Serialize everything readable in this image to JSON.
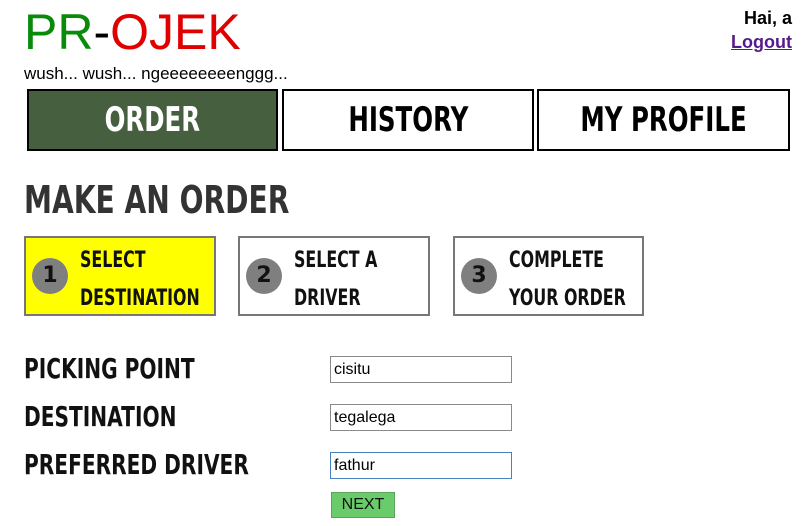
{
  "brand": {
    "part1": "PR",
    "separator": "-",
    "part2": "OJEK",
    "tagline": "wush... wush... ngeeeeeeeenggg..."
  },
  "user": {
    "greeting": "Hai, a",
    "logout_label": "Logout"
  },
  "nav": {
    "tabs": [
      {
        "label": "ORDER"
      },
      {
        "label": "HISTORY"
      },
      {
        "label": "MY PROFILE"
      }
    ]
  },
  "page": {
    "title": "MAKE AN ORDER"
  },
  "steps": [
    {
      "number": "1",
      "line1": "SELECT",
      "line2": "DESTINATION"
    },
    {
      "number": "2",
      "line1": "SELECT A",
      "line2": "DRIVER"
    },
    {
      "number": "3",
      "line1": "COMPLETE",
      "line2": "YOUR ORDER"
    }
  ],
  "form": {
    "picking_label": "PICKING POINT",
    "picking_value": "cisitu",
    "destination_label": "DESTINATION",
    "destination_value": "tegalega",
    "driver_label": "PREFERRED DRIVER",
    "driver_value": "fathur",
    "next_label": "NEXT"
  },
  "colors": {
    "brand_green": "#0a8a0a",
    "brand_red": "#e00000",
    "active_tab": "#46603f",
    "active_step": "#ffff00",
    "next_button": "#6acb6a"
  }
}
